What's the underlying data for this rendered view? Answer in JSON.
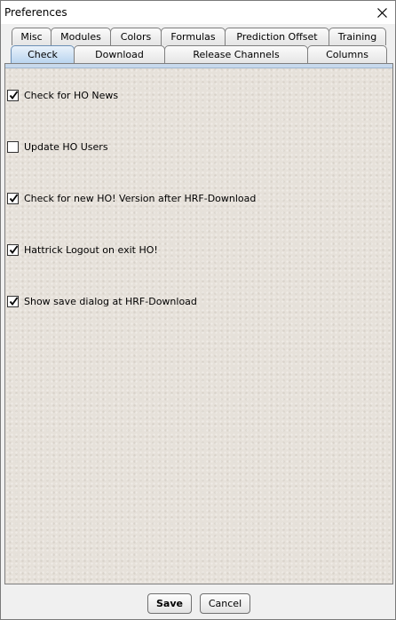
{
  "window": {
    "title": "Preferences",
    "close_icon": "close-icon"
  },
  "tabs": {
    "row1": [
      {
        "label": "Misc"
      },
      {
        "label": "Modules"
      },
      {
        "label": "Colors"
      },
      {
        "label": "Formulas"
      },
      {
        "label": "Prediction Offset"
      },
      {
        "label": "Training"
      }
    ],
    "row2": [
      {
        "label": "Check",
        "selected": true
      },
      {
        "label": "Download",
        "selected": false
      },
      {
        "label": "Release Channels",
        "selected": false
      },
      {
        "label": "Columns",
        "selected": false
      }
    ]
  },
  "options": [
    {
      "label": "Check for HO News",
      "checked": true
    },
    {
      "label": "Update HO Users",
      "checked": false
    },
    {
      "label": "Check for new HO! Version after HRF-Download",
      "checked": true
    },
    {
      "label": "Hattrick Logout on exit HO!",
      "checked": true
    },
    {
      "label": "Show save dialog at HRF-Download",
      "checked": true
    }
  ],
  "buttons": {
    "save": "Save",
    "cancel": "Cancel"
  },
  "colors": {
    "selected_tab": "#b7d3ee",
    "panel_background": "#e6e1da"
  }
}
